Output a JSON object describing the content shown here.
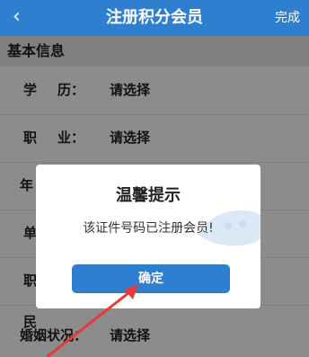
{
  "navbar": {
    "back_icon": "‹",
    "title": "注册积分会员",
    "done_label": "完成"
  },
  "section": {
    "title": "基本信息"
  },
  "form": {
    "fields": [
      {
        "label_a": "学",
        "label_b": "历：",
        "value": "请选择"
      },
      {
        "label_a": "职",
        "label_b": "业：",
        "value": "请选择"
      },
      {
        "label_a": "年",
        "label_b": "",
        "value": ""
      },
      {
        "label_a": "单",
        "label_b": "",
        "value": ""
      },
      {
        "label_a": "职",
        "label_b": "",
        "value": ""
      },
      {
        "label_a": "民",
        "label_b": "",
        "value": ""
      },
      {
        "label": "婚姻状况：",
        "value": "请选择"
      }
    ]
  },
  "dialog": {
    "title": "温馨提示",
    "message": "该证件号码已注册会员!",
    "confirm_label": "确定"
  },
  "colors": {
    "primary": "#2f7fd0",
    "annotation_arrow": "#e63a3a"
  }
}
